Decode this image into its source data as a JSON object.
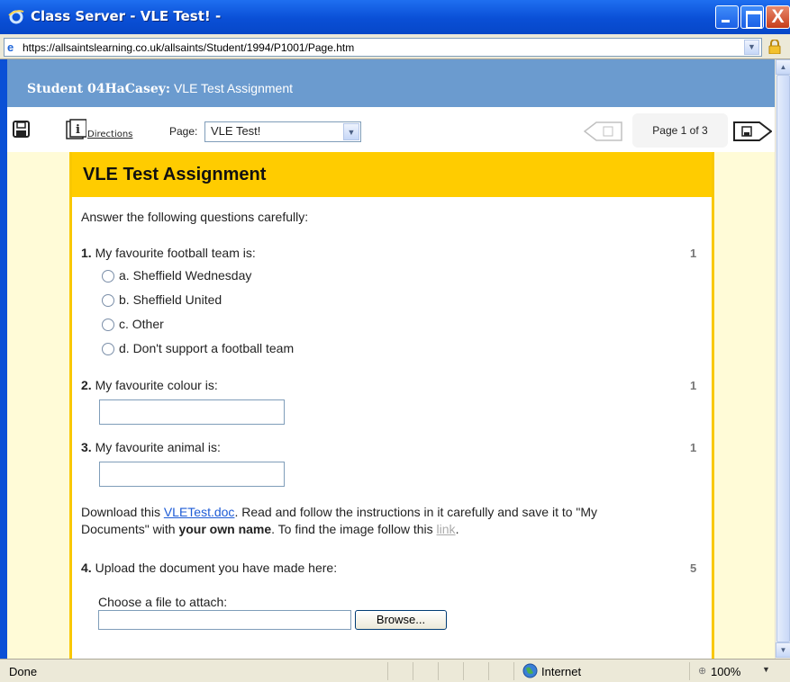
{
  "window": {
    "title": "Class Server - VLE Test! -",
    "close_glyph": "X"
  },
  "address": {
    "url": "https://allsaintslearning.co.uk/allsaints/Student/1994/P1001/Page.htm"
  },
  "header": {
    "student": "Student 04HaCasey:",
    "assignment": "VLE Test Assignment"
  },
  "toolbar": {
    "directions_label": "Directions",
    "page_label": "Page:",
    "page_selected": "VLE Test!",
    "page_counter": "Page 1 of 3"
  },
  "assignment": {
    "title": "VLE Test Assignment",
    "intro": "Answer the following questions carefully:",
    "q1": {
      "number": "1.",
      "text": "My favourite football team is:",
      "marks": "1",
      "options": [
        "a. Sheffield Wednesday",
        "b. Sheffield United",
        "c. Other",
        "d. Don't support a football team"
      ]
    },
    "q2": {
      "number": "2.",
      "text": "My favourite colour is:",
      "marks": "1",
      "value": ""
    },
    "q3": {
      "number": "3.",
      "text": "My favourite animal is:",
      "marks": "1",
      "value": ""
    },
    "download": {
      "prefix": "Download this ",
      "file_link": "VLETest.doc",
      "middle": ". Read and follow the instructions in it carefully and save it to \"My",
      "line2_prefix": "Documents\" with ",
      "bold": "your own name",
      "line2_middle": ". To find the image follow this ",
      "image_link": "link",
      "line2_suffix": "."
    },
    "q4": {
      "number": "4.",
      "text": "Upload the document you have made here:",
      "marks": "5",
      "file_label": "Choose a file to attach:",
      "file_value": "",
      "browse_label": "Browse..."
    }
  },
  "status": {
    "text": "Done",
    "zone": "Internet",
    "zoom": "100%"
  },
  "colors": {
    "title_bar": "#0a4fd6",
    "header_band": "#6b9bcf",
    "banner": "#ffcc00",
    "page_bg": "#fffbd7",
    "link": "#1d5bd6"
  },
  "icons": [
    "ie-icon",
    "page-icon",
    "lock-icon",
    "save-icon",
    "directions-icon",
    "prev-page-icon",
    "next-page-icon",
    "globe-icon",
    "zoom-icon"
  ]
}
